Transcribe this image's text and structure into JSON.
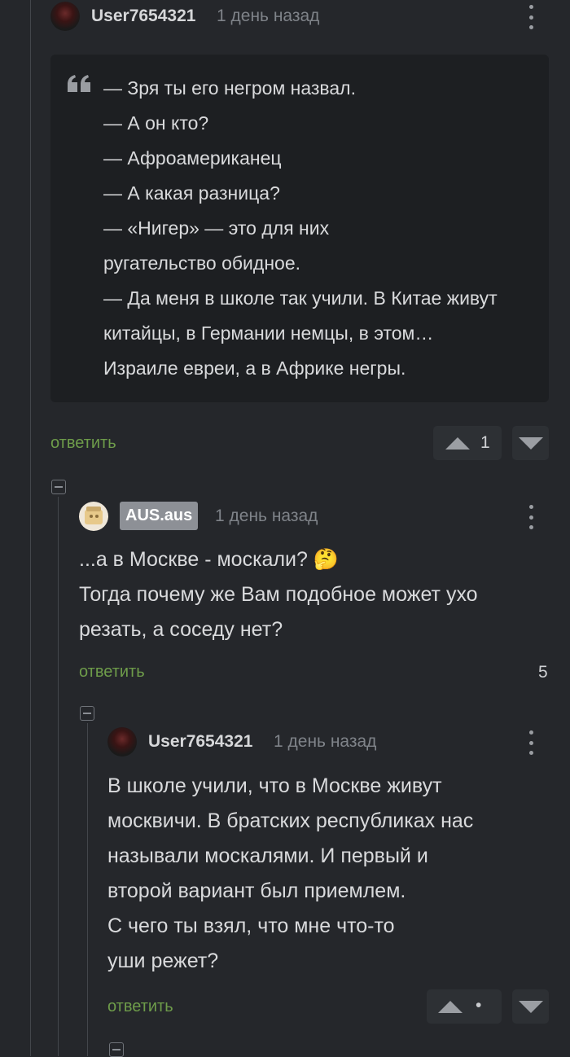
{
  "comment1": {
    "username": "User7654321",
    "time": "1 день назад",
    "quote_lines": [
      "— Зря ты его негром назвал.",
      "— А он кто?",
      "— Афроамериканец",
      "— А какая разница?",
      "— «Нигер» — это для них",
      "ругательство обидное.",
      "— Да меня в школе так учили. В Китае живут",
      "китайцы, в Германии немцы, в этом…",
      "Израиле евреи, а в Африке негры."
    ],
    "reply_label": "ответить",
    "rating": "1"
  },
  "comment2": {
    "username": "AUS.aus",
    "time": "1 день назад",
    "lines": [
      "...а в Москве - москали? 🤔",
      "Тогда почему же Вам подобное может ухо",
      "резать, а соседу нет?"
    ],
    "reply_label": "ответить",
    "rating": "5"
  },
  "comment3": {
    "username": "User7654321",
    "time": "1 день назад",
    "lines": [
      "В школе учили, что в Москве живут",
      "москвичи. В братских республиках нас",
      "называли москалями. И первый и",
      "второй вариант был приемлем.",
      "С чего ты взял, что мне что-то",
      "уши режет?"
    ],
    "reply_label": "ответить",
    "rating": "•"
  },
  "icons": {
    "quote": "quote-icon",
    "more": "kebab-menu-icon",
    "collapse": "collapse-minus-icon",
    "upvote": "upvote-arrow-icon",
    "downvote": "downvote-arrow-icon"
  },
  "colors": {
    "background": "#25272b",
    "quote_bg": "#1d1f22",
    "reply_link": "#6e9c4a"
  }
}
